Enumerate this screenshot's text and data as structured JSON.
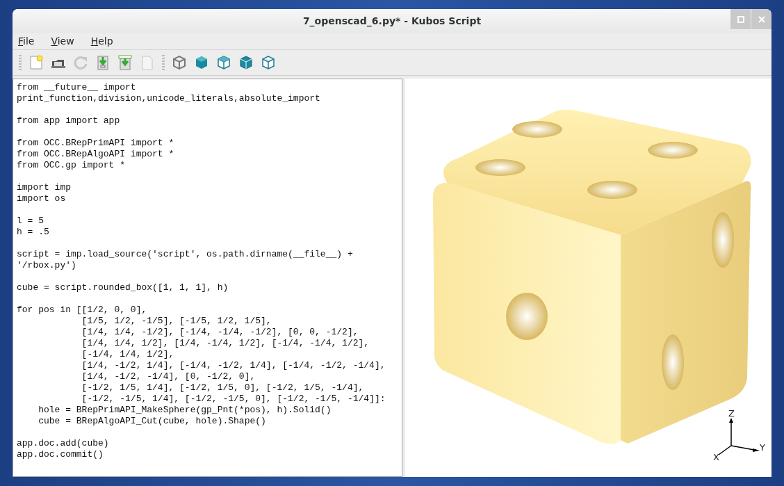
{
  "window": {
    "title": "7_openscad_6.py* - Kubos Script"
  },
  "menu": [
    {
      "label": "File"
    },
    {
      "label": "View"
    },
    {
      "label": "Help"
    }
  ],
  "toolbar": [
    [
      {
        "kind": "new",
        "disabled": false
      },
      {
        "kind": "open",
        "disabled": false
      },
      {
        "kind": "reload",
        "disabled": true
      },
      {
        "kind": "save",
        "disabled": false
      },
      {
        "kind": "saveas",
        "disabled": false
      },
      {
        "kind": "page",
        "disabled": true
      }
    ],
    [
      {
        "kind": "wire",
        "disabled": false
      },
      {
        "kind": "solid",
        "disabled": false
      },
      {
        "kind": "edges",
        "disabled": false
      },
      {
        "kind": "mixed",
        "disabled": false
      },
      {
        "kind": "outline",
        "disabled": false
      }
    ]
  ],
  "editor": {
    "blocks": [
      [
        "from __future__ import",
        "print_function,division,unicode_literals,absolute_import"
      ],
      [
        "from app import app"
      ],
      [
        "from OCC.BRepPrimAPI import *",
        "from OCC.BRepAlgoAPI import *",
        "from OCC.gp import *"
      ],
      [
        "import imp",
        "import os"
      ],
      [
        "l = 5",
        "h = .5"
      ],
      [
        "script = imp.load_source('script', os.path.dirname(__file__) +",
        "'/rbox.py')"
      ],
      [
        "cube = script.rounded_box([1, 1, 1], h)"
      ],
      [
        "for pos in [[1/2, 0, 0],",
        "            [1/5, 1/2, -1/5], [-1/5, 1/2, 1/5],",
        "            [1/4, 1/4, -1/2], [-1/4, -1/4, -1/2], [0, 0, -1/2],",
        "            [1/4, 1/4, 1/2], [1/4, -1/4, 1/2], [-1/4, -1/4, 1/2],",
        "            [-1/4, 1/4, 1/2],",
        "            [1/4, -1/2, 1/4], [-1/4, -1/2, 1/4], [-1/4, -1/2, -1/4],",
        "            [1/4, -1/2, -1/4], [0, -1/2, 0],",
        "            [-1/2, 1/5, 1/4], [-1/2, 1/5, 0], [-1/2, 1/5, -1/4],",
        "            [-1/2, -1/5, 1/4], [-1/2, -1/5, 0], [-1/2, -1/5, -1/4]]:",
        "    hole = BRepPrimAPI_MakeSphere(gp_Pnt(*pos), h).Solid()",
        "    cube = BRepAlgoAPI_Cut(cube, hole).Shape()"
      ],
      [
        "app.doc.add(cube)",
        "app.doc.commit()"
      ]
    ]
  },
  "viewer": {
    "axes": {
      "z": "Z",
      "y": "Y",
      "x": "X"
    }
  }
}
